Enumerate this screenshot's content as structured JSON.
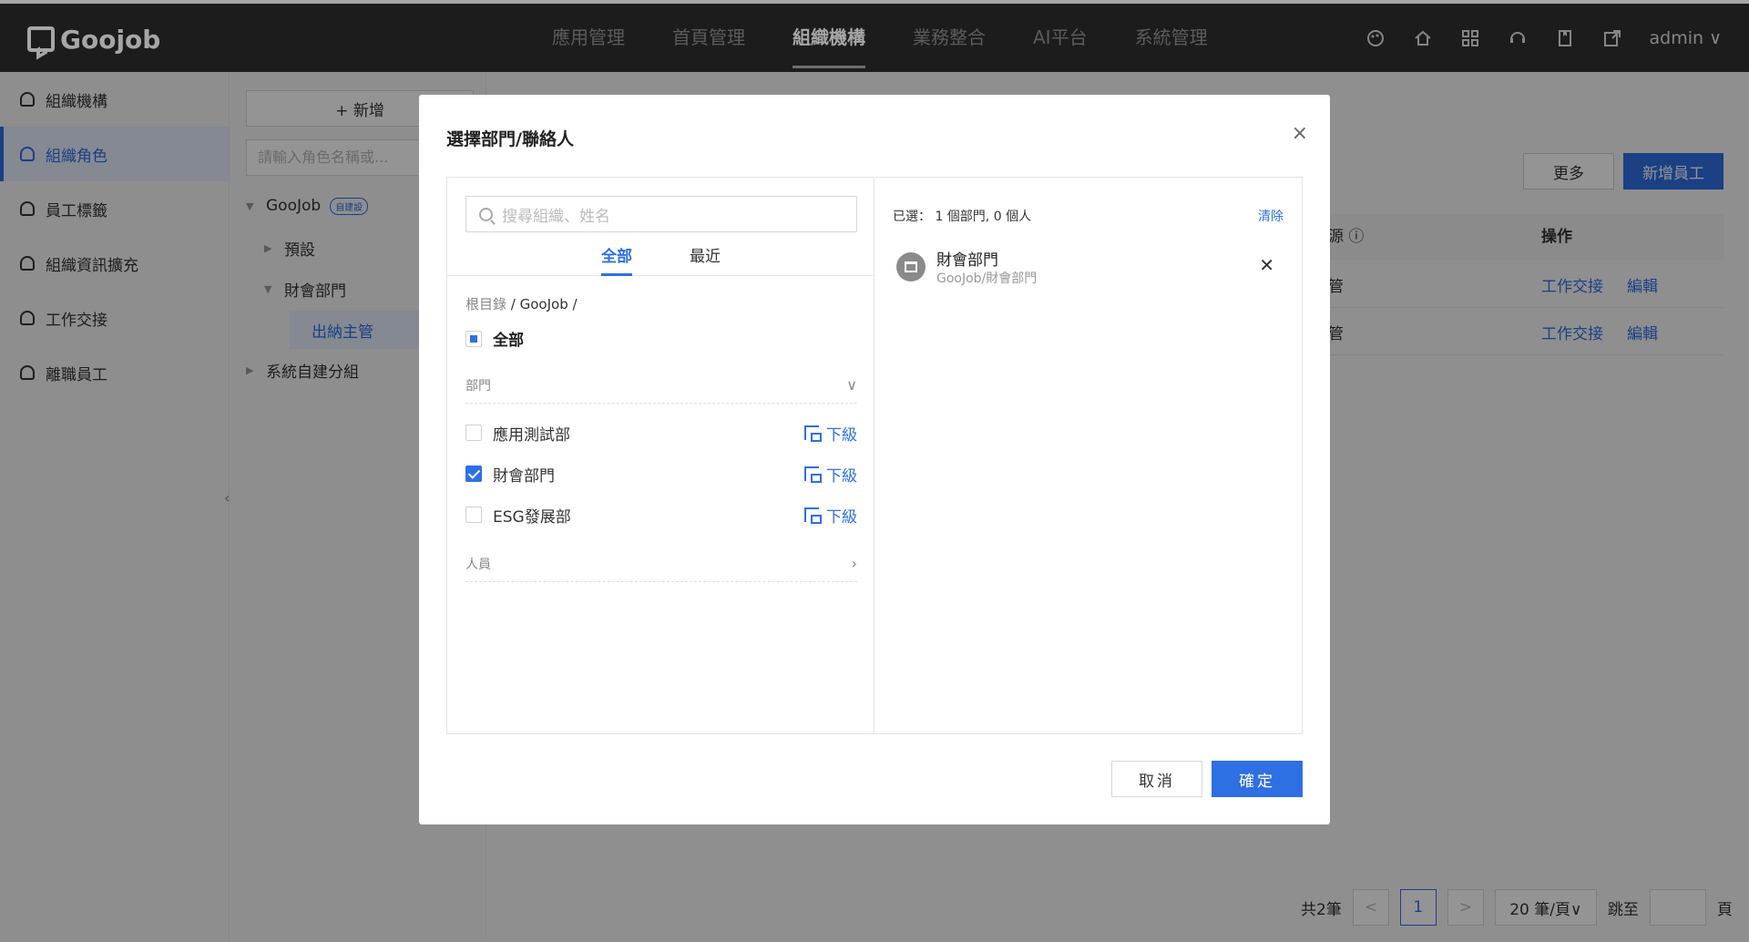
{
  "header": {
    "brand": "Goojob",
    "nav": [
      "應用管理",
      "首頁管理",
      "組織機構",
      "業務整合",
      "AI平台",
      "系統管理"
    ],
    "active_nav": "組織機構",
    "user": "admin ∨"
  },
  "sidebar": {
    "items": [
      {
        "label": "組織機構",
        "icon": "org-icon"
      },
      {
        "label": "組織角色",
        "icon": "role-icon",
        "active": true
      },
      {
        "label": "員工標籤",
        "icon": "tag-icon"
      },
      {
        "label": "組織資訊擴充",
        "icon": "user-icon"
      },
      {
        "label": "工作交接",
        "icon": "handover-icon"
      },
      {
        "label": "離職員工",
        "icon": "leave-icon"
      }
    ]
  },
  "role_tree": {
    "add_label": "+ 新增",
    "search_placeholder": "請輸入角色名稱或...",
    "root": "GooJob",
    "root_badge": "自建設",
    "nodes": [
      "預設",
      "財會部門",
      "出納主管",
      "系統自建分組"
    ]
  },
  "main": {
    "more_label": "更多",
    "new_employee_label": "新增員工",
    "col_partial": "源 ⓘ",
    "col_op": "操作",
    "rows": [
      {
        "partial": "管",
        "handover": "工作交接",
        "edit": "編輯"
      },
      {
        "partial": "管",
        "handover": "工作交接",
        "edit": "編輯"
      }
    ],
    "pager": {
      "total": "共2筆",
      "prev": "<",
      "page": "1",
      "next": ">",
      "size": "20 筆/頁∨",
      "jump": "跳至",
      "page_unit": "頁"
    }
  },
  "modal": {
    "title": "選擇部門/聯絡人",
    "close": "×",
    "search_placeholder": "搜尋組織、姓名",
    "tabs": [
      "全部",
      "最近"
    ],
    "crumb_root": "根目錄",
    "crumb_path": "/ GooJob /",
    "all_label": "全部",
    "section_dept": "部門",
    "section_people": "人員",
    "sub_label": "下級",
    "departments": [
      {
        "name": "應用測試部",
        "checked": false
      },
      {
        "name": "財會部門",
        "checked": true
      },
      {
        "name": "ESG發展部",
        "checked": false
      }
    ],
    "selected_summary": "已選： 1 個部門, 0 個人",
    "clear_label": "清除",
    "selected": [
      {
        "name": "財會部門",
        "path": "GooJob/財會部門"
      }
    ],
    "cancel_label": "取消",
    "ok_label": "確定"
  }
}
